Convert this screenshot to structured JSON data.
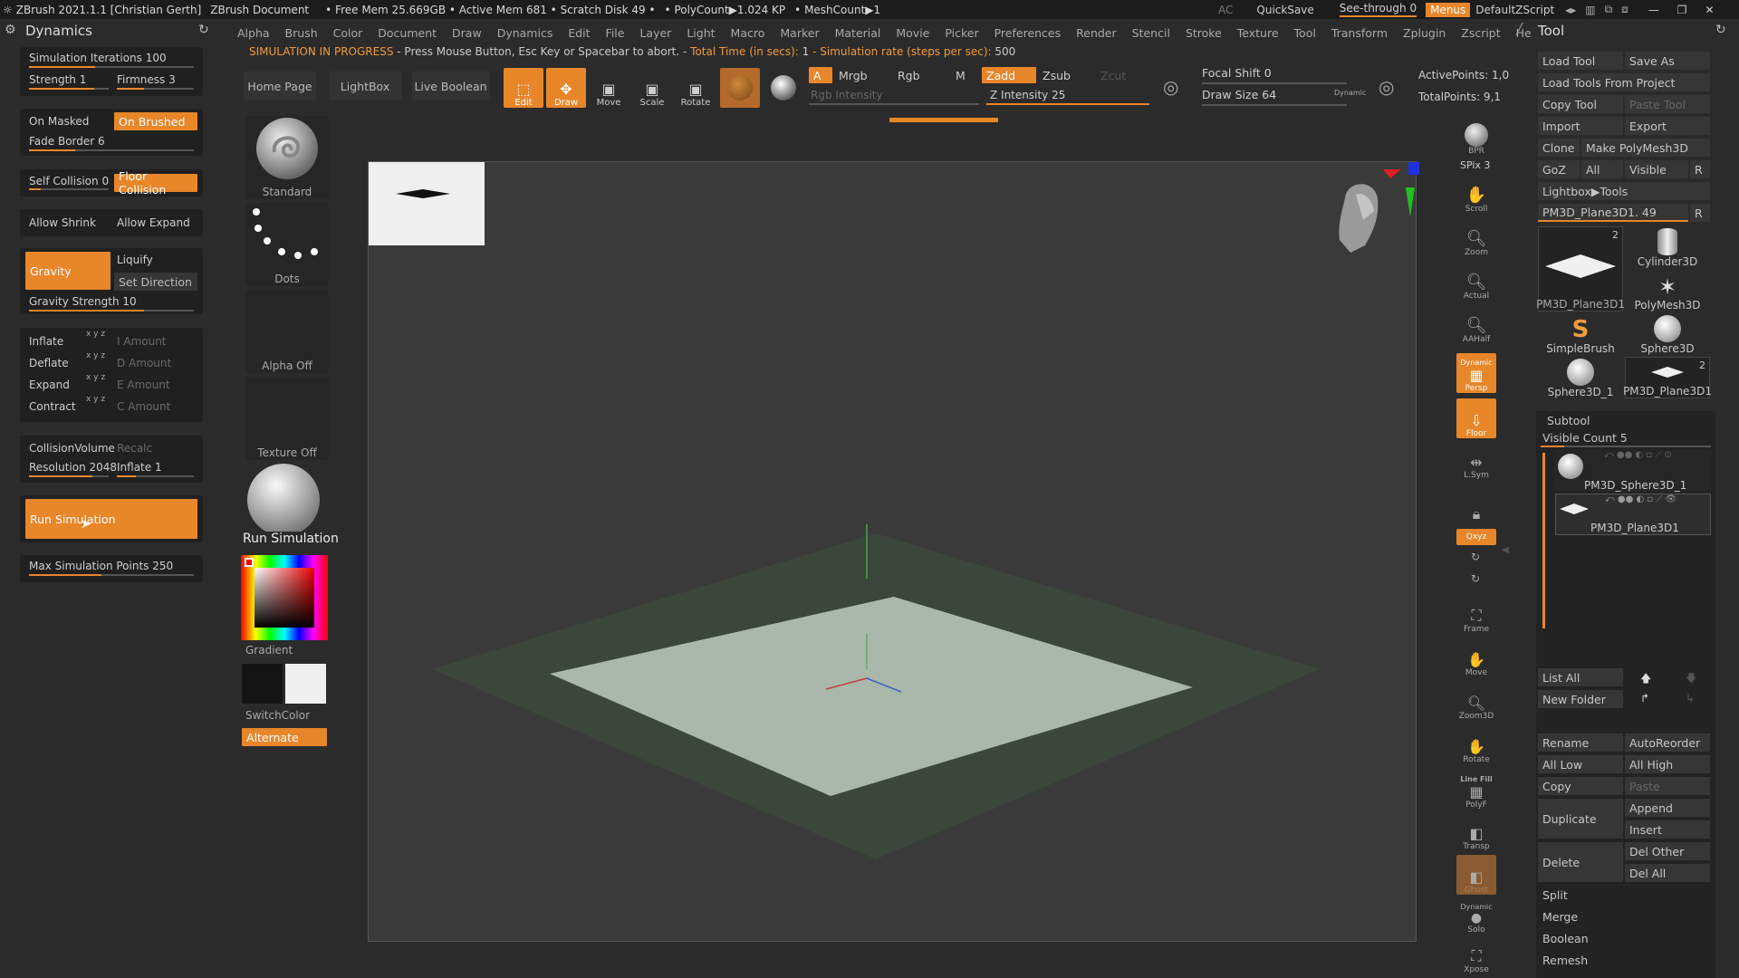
{
  "titlebar": {
    "app": "ZBrush 2021.1.1 [Christian Gerth]",
    "doc": "ZBrush Document",
    "free_mem": "• Free Mem 25.669GB • Active Mem 681 • Scratch Disk 49 •",
    "polycount": "• PolyCount▶1.024 KP",
    "meshcount": "• MeshCount▶1",
    "ac": "AC",
    "quicksave": "QuickSave",
    "see_through": "See-through  0",
    "menus": "Menus",
    "default_zscript": "DefaultZScript"
  },
  "menubar": [
    "Alpha",
    "Brush",
    "Color",
    "Document",
    "Draw",
    "Dynamics",
    "Edit",
    "File",
    "Layer",
    "Light",
    "Macro",
    "Marker",
    "Material",
    "Movie",
    "Picker",
    "Preferences",
    "Render",
    "Stencil",
    "Stroke",
    "Texture",
    "Tool",
    "Transform",
    "Zplugin",
    "Zscript",
    "Help"
  ],
  "status": {
    "a": "SIMULATION IN PROGRESS",
    "b": " - Press Mouse Button, Esc Key or Spacebar to abort. - ",
    "c": "Total Time (in secs): ",
    "d": "1",
    "e": " - Simulation rate (steps per sec): ",
    "f": "500"
  },
  "dynamics": {
    "title": "Dynamics",
    "sim_iterations": "Simulation Iterations 100",
    "strength": "Strength 1",
    "firmness": "Firmness 3",
    "on_masked": "On Masked",
    "on_brushed": "On Brushed",
    "fade_border": "Fade Border 6",
    "self_collision": "Self Collision 0",
    "floor_collision": "Floor Collision",
    "allow_shrink": "Allow Shrink",
    "allow_expand": "Allow Expand",
    "gravity": "Gravity",
    "liquify": "Liquify",
    "set_direction": "Set Direction",
    "gravity_strength": "Gravity Strength 10",
    "inflate": "Inflate",
    "deflate": "Deflate",
    "expand": "Expand",
    "contract": "Contract",
    "xyz": "x y z",
    "i_amount": "I Amount",
    "d_amount": "D Amount",
    "e_amount": "E Amount",
    "c_amount": "C Amount",
    "collision_volume": "CollisionVolume",
    "recalc": "Recalc",
    "resolution": "Resolution 2048",
    "inflate1": "Inflate 1",
    "run_simulation": "Run Simulation",
    "max_sim_points": "Max Simulation Points 250"
  },
  "col2": {
    "standard": "Standard",
    "dots": "Dots",
    "alpha_off": "Alpha Off",
    "texture_off": "Texture Off",
    "tooltip": "Run Simulation",
    "gradient": "Gradient",
    "switch_color": "SwitchColor",
    "alternate": "Alternate"
  },
  "toolbar": {
    "home_page": "Home Page",
    "lightbox": "LightBox",
    "live_boolean": "Live Boolean",
    "edit": "Edit",
    "draw": "Draw",
    "move": "Move",
    "scale": "Scale",
    "rotate": "Rotate",
    "a": "A",
    "mrgb": "Mrgb",
    "rgb": "Rgb",
    "m": "M",
    "rgb_intensity": "Rgb Intensity",
    "zadd": "Zadd",
    "zsub": "Zsub",
    "zcut": "Zcut",
    "z_intensity": "Z Intensity 25",
    "focal_shift": "Focal Shift 0",
    "draw_size": "Draw Size 64",
    "dynamic": "Dynamic",
    "active_points": "ActivePoints: 1,0",
    "total_points": "TotalPoints: 9,1"
  },
  "rightstrip": {
    "bpr": "BPR",
    "spix": "SPix 3",
    "scroll": "Scroll",
    "zoom": "Zoom",
    "actual": "Actual",
    "aahalf": "AAHalf",
    "persp": "Persp",
    "dynamic": "Dynamic",
    "floor": "Floor",
    "lsym": "L.Sym",
    "xyz": "Qxyz",
    "frame": "Frame",
    "move": "Move",
    "zoom3d": "Zoom3D",
    "rotate": "Rotate",
    "linefill": "Line Fill",
    "polyf": "PolyF",
    "transp": "Transp",
    "ghost": "Ghost",
    "solo": "Solo",
    "dynamic2": "Dynamic",
    "xpose": "Xpose"
  },
  "tool": {
    "title": "Tool",
    "load_tool": "Load Tool",
    "save_as": "Save As",
    "load_from_project": "Load Tools From Project",
    "copy_tool": "Copy Tool",
    "paste_tool": "Paste Tool",
    "import": "Import",
    "export": "Export",
    "clone": "Clone",
    "make_polymesh": "Make PolyMesh3D",
    "goz": "GoZ",
    "all": "All",
    "visible": "Visible",
    "r": "R",
    "lightbox_tools": "Lightbox▶Tools",
    "current_tool": "PM3D_Plane3D1. 49",
    "tools": [
      {
        "name": "PM3D_Plane3D1",
        "badge": "2"
      },
      {
        "name": "Cylinder3D",
        "badge": ""
      },
      {
        "name": "PolyMesh3D",
        "badge": ""
      },
      {
        "name": "SimpleBrush",
        "badge": ""
      },
      {
        "name": "Sphere3D",
        "badge": ""
      },
      {
        "name": "Sphere3D_1",
        "badge": ""
      },
      {
        "name": "PM3D_Plane3D1",
        "badge": "2"
      }
    ],
    "subtool": "Subtool",
    "visible_count": "Visible Count 5",
    "subtools": [
      "PM3D_Sphere3D_1",
      "PM3D_Plane3D1"
    ],
    "list_all": "List All",
    "new_folder": "New Folder",
    "rename": "Rename",
    "autoreorder": "AutoReorder",
    "all_low": "All Low",
    "all_high": "All High",
    "copy": "Copy",
    "paste": "Paste",
    "duplicate": "Duplicate",
    "append": "Append",
    "insert": "Insert",
    "delete": "Delete",
    "del_other": "Del Other",
    "del_all": "Del All",
    "split": "Split",
    "merge": "Merge",
    "boolean": "Boolean",
    "remesh": "Remesh"
  },
  "colors": {
    "accent": "#e8862a",
    "panel": "#202020",
    "bg": "#2b2b2b"
  }
}
